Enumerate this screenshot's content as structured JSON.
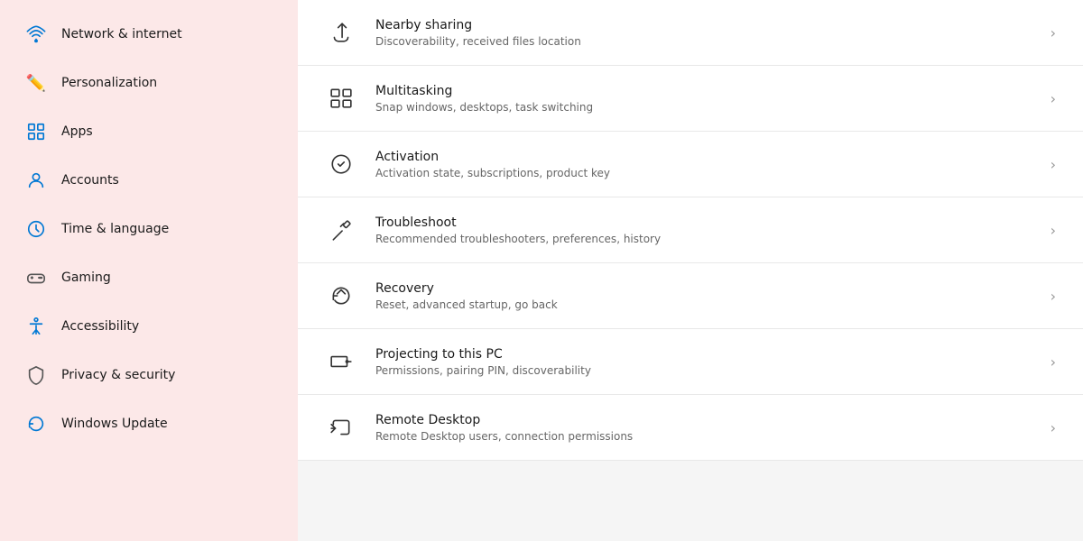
{
  "sidebar": {
    "items": [
      {
        "id": "network",
        "label": "Network & internet",
        "icon": "🌐",
        "color": "#0078d4"
      },
      {
        "id": "personalization",
        "label": "Personalization",
        "icon": "✏️",
        "color": "#e74856"
      },
      {
        "id": "apps",
        "label": "Apps",
        "icon": "🟦",
        "color": "#0078d4"
      },
      {
        "id": "accounts",
        "label": "Accounts",
        "icon": "🧑",
        "color": "#0078d4"
      },
      {
        "id": "time",
        "label": "Time & language",
        "icon": "🌍",
        "color": "#0078d4"
      },
      {
        "id": "gaming",
        "label": "Gaming",
        "icon": "🎮",
        "color": "#6b6b6b"
      },
      {
        "id": "accessibility",
        "label": "Accessibility",
        "icon": "♿",
        "color": "#0078d4"
      },
      {
        "id": "privacy",
        "label": "Privacy & security",
        "icon": "🛡️",
        "color": "#6b6b6b"
      },
      {
        "id": "winupdate",
        "label": "Windows Update",
        "icon": "🔄",
        "color": "#0078d4"
      }
    ]
  },
  "main": {
    "items": [
      {
        "id": "nearby-sharing",
        "title": "Nearby sharing",
        "desc": "Discoverability, received files location",
        "icon": "nearby"
      },
      {
        "id": "multitasking",
        "title": "Multitasking",
        "desc": "Snap windows, desktops, task switching",
        "icon": "multitasking"
      },
      {
        "id": "activation",
        "title": "Activation",
        "desc": "Activation state, subscriptions, product key",
        "icon": "activation"
      },
      {
        "id": "troubleshoot",
        "title": "Troubleshoot",
        "desc": "Recommended troubleshooters, preferences, history",
        "icon": "troubleshoot"
      },
      {
        "id": "recovery",
        "title": "Recovery",
        "desc": "Reset, advanced startup, go back",
        "icon": "recovery"
      },
      {
        "id": "projecting",
        "title": "Projecting to this PC",
        "desc": "Permissions, pairing PIN, discoverability",
        "icon": "projecting"
      },
      {
        "id": "remote-desktop",
        "title": "Remote Desktop",
        "desc": "Remote Desktop users, connection permissions",
        "icon": "remote"
      }
    ]
  }
}
